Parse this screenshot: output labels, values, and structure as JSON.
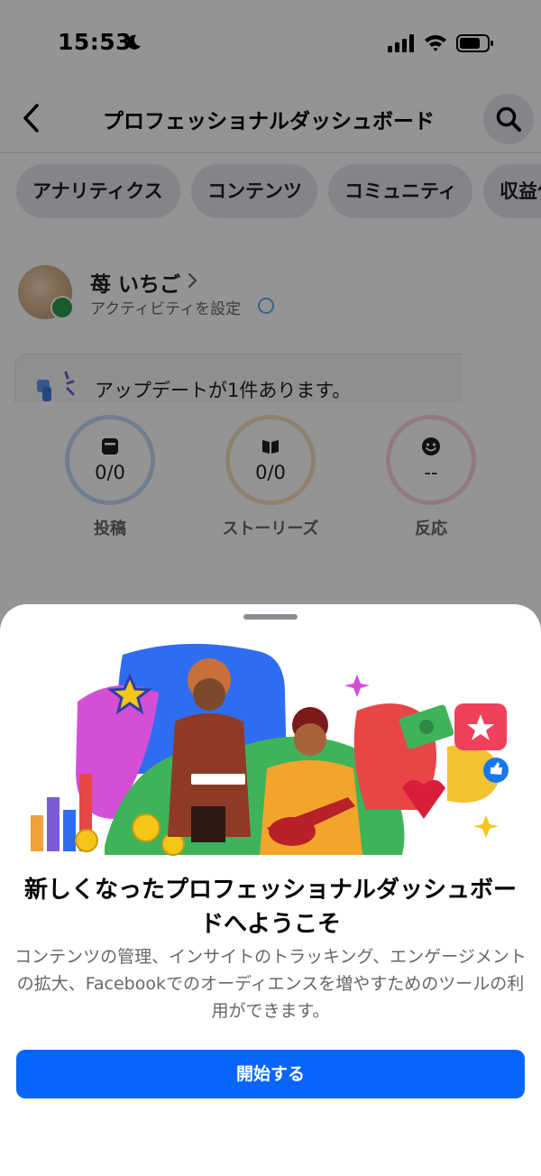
{
  "status_bar": {
    "time": "15:53",
    "icons": [
      "moon-icon",
      "signal-icon",
      "wifi-icon",
      "battery-icon"
    ]
  },
  "nav": {
    "title": "プロフェッショナルダッシュボード",
    "back_icon": "back-icon",
    "search_icon": "search-icon"
  },
  "tabs": [
    {
      "label": "アナリティクス"
    },
    {
      "label": "コンテンツ"
    },
    {
      "label": "コミュニティ"
    },
    {
      "label": "収益化"
    }
  ],
  "profile": {
    "name": "苺 いちご",
    "subtitle": "アクティビティを設定"
  },
  "update_card": {
    "text": "アップデートが1件あります。"
  },
  "stats": [
    {
      "value": "0/0",
      "label": "投稿",
      "icon": "post-icon",
      "color": "#c4daf5"
    },
    {
      "value": "0/0",
      "label": "ストーリーズ",
      "icon": "story-icon",
      "color": "#f5ddc0"
    },
    {
      "value": "--",
      "label": "反応",
      "icon": "reaction-icon",
      "color": "#f5d2dd"
    }
  ],
  "sheet": {
    "title": "新しくなったプロフェッショナルダッシュボードへようこそ",
    "body": "コンテンツの管理、インサイトのトラッキング、エンゲージメントの拡大、Facebookでのオーディエンスを増やすためのツールの利用ができます。",
    "button_label": "開始する",
    "button_color": "#0866ff"
  }
}
